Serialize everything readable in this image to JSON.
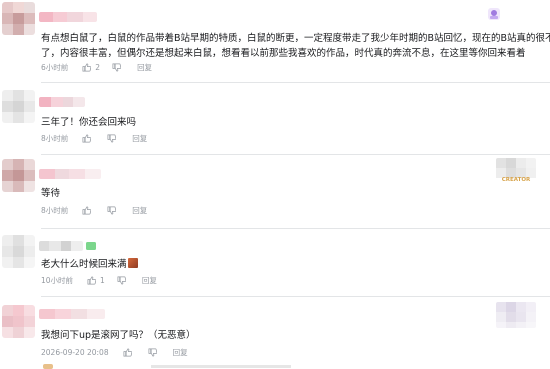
{
  "comments": [
    {
      "lines": [
        "有点想白鼠了，白鼠的作品带着B站早期的特质，白鼠的断更，一定程度带走了我少年时期的B站回忆，现在的B站真的很不一样",
        "了，内容很丰富，但偶尔还是想起来白鼠，想看看以前那些我喜欢的作品，时代真的奔流不息，在这里等你回来看着"
      ],
      "time": "6小时前",
      "likes": "2",
      "reply_label": "回复"
    },
    {
      "lines": [
        "三年了！你还会回来吗"
      ],
      "time": "8小时前",
      "likes": "",
      "reply_label": "回复"
    },
    {
      "lines": [
        "等待"
      ],
      "time": "8小时前",
      "likes": "",
      "reply_label": "回复",
      "decor_tag": "CREATOR"
    },
    {
      "lines": [
        "老大什么时候回来满"
      ],
      "time": "10小时前",
      "likes": "1",
      "reply_label": "回复"
    },
    {
      "lines": [
        "我想问下up是滚网了吗？（无恶意）"
      ],
      "time": "2026-09-20 20:08",
      "likes": "",
      "reply_label": "回复"
    }
  ],
  "icons": {
    "like": "thumb-up-icon",
    "dislike": "thumb-down-icon",
    "badge": "fan-badge-icon",
    "sticker": "emoji-sticker-icon"
  },
  "colors": {
    "text": "#18191c",
    "meta": "#9499a0",
    "divider": "#e3e5e7",
    "accent": "#fb7299"
  }
}
